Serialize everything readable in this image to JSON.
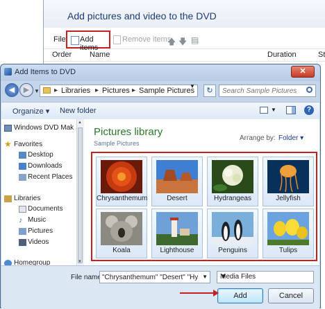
{
  "background_window": {
    "heading": "Add pictures and video to the DVD",
    "toolbar": {
      "file": "File",
      "add_items": "Add items",
      "remove_items": "Remove items"
    },
    "columns": [
      "Order",
      "Name",
      "Duration",
      "Sta"
    ]
  },
  "dialog": {
    "title": "Add Items to DVD",
    "close_glyph": "✕",
    "breadcrumbs": [
      "Libraries",
      "Pictures",
      "Sample Pictures"
    ],
    "search_placeholder": "Search Sample Pictures",
    "commands": {
      "organize": "Organize ▾",
      "new_folder": "New folder"
    },
    "nav": {
      "computer": "Windows DVD Mak",
      "favorites": "Favorites",
      "favorites_items": [
        "Desktop",
        "Downloads",
        "Recent Places"
      ],
      "libraries": "Libraries",
      "library_items": [
        "Documents",
        "Music",
        "Pictures",
        "Videos"
      ],
      "homegroup": "Homegroup"
    },
    "library": {
      "title": "Pictures library",
      "subtitle": "Sample Pictures",
      "arrange_label": "Arrange by:",
      "arrange_value": "Folder ▾"
    },
    "pictures": [
      "Chrysanthemum",
      "Desert",
      "Hydrangeas",
      "Jellyfish",
      "Koala",
      "Lighthouse",
      "Penguins",
      "Tulips"
    ],
    "file_name_label": "File name:",
    "file_name_value": "\"Chrysanthemum\" \"Desert\" \"Hydrange",
    "file_type": "Media Files",
    "add_button": "Add",
    "cancel_button": "Cancel"
  },
  "colors": {
    "highlight_red": "#c42020",
    "library_green": "#2a7a2a"
  }
}
